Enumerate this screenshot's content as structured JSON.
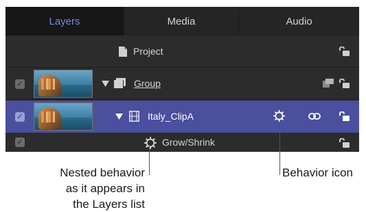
{
  "tabs": [
    {
      "label": "Layers",
      "active": true
    },
    {
      "label": "Media",
      "active": false
    },
    {
      "label": "Audio",
      "active": false
    }
  ],
  "rows": {
    "project": {
      "label": "Project"
    },
    "group": {
      "label": "Group",
      "checked": true
    },
    "clip": {
      "label": "Italy_ClipA",
      "checked": true
    },
    "behavior": {
      "label": "Grow/Shrink",
      "checked": true
    }
  },
  "annotations": {
    "nested_line1": "Nested behavior",
    "nested_line2": "as it appears in",
    "nested_line3": "the Layers list",
    "behavior_icon": "Behavior icon"
  },
  "colors": {
    "panel_bg": "#2c2c2c",
    "selected_row": "#4a4f9e",
    "active_tab_text": "#7b86e6"
  },
  "icons": {
    "project": "document-icon",
    "group": "group-icon",
    "clip": "film-icon",
    "behavior": "gear-icon",
    "link": "link-icon",
    "lock": "lock-icon"
  }
}
